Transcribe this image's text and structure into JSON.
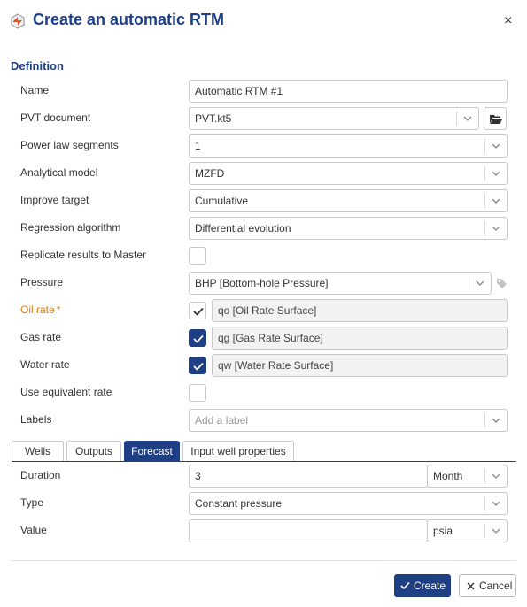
{
  "dialog": {
    "title": "Create an automatic RTM",
    "close_glyph": "×"
  },
  "definition": {
    "section_title": "Definition",
    "name_label": "Name",
    "name_value": "Automatic RTM #1",
    "pvt_label": "PVT document",
    "pvt_value": "PVT.kt5",
    "power_label": "Power law segments",
    "power_value": "1",
    "analytical_label": "Analytical model",
    "analytical_value": "MZFD",
    "improve_label": "Improve target",
    "improve_value": "Cumulative",
    "regression_label": "Regression algorithm",
    "regression_value": "Differential evolution",
    "replicate_label": "Replicate results to Master",
    "replicate_checked": false,
    "pressure_label": "Pressure",
    "pressure_value": "BHP [Bottom-hole Pressure]",
    "oil_label": "Oil rate",
    "oil_required": "*",
    "oil_checked": true,
    "oil_value": "qo [Oil Rate Surface]",
    "gas_label": "Gas rate",
    "gas_checked": true,
    "gas_value": "qg [Gas Rate Surface]",
    "water_label": "Water rate",
    "water_checked": true,
    "water_value": "qw [Water Rate Surface]",
    "equiv_label": "Use equivalent rate",
    "equiv_checked": false,
    "labels_label": "Labels",
    "labels_placeholder": "Add a label"
  },
  "tabs": [
    {
      "label": "Wells",
      "active": false
    },
    {
      "label": "Outputs",
      "active": false
    },
    {
      "label": "Forecast",
      "active": true
    },
    {
      "label": "Input well properties",
      "active": false
    }
  ],
  "forecast": {
    "duration_label": "Duration",
    "duration_value": "3",
    "duration_unit": "Month",
    "type_label": "Type",
    "type_value": "Constant pressure",
    "value_label": "Value",
    "value_value": "",
    "value_unit": "psia"
  },
  "footer": {
    "create_label": "Create",
    "cancel_label": "Cancel"
  },
  "colors": {
    "accent": "#1e3f84",
    "required": "#d97b12"
  },
  "icons": {
    "app": "rtm-app-icon",
    "folder": "folder-open-icon",
    "tag": "tag-icon",
    "chevron": "chevron-down-icon",
    "check": "check-icon",
    "close": "close-icon"
  }
}
